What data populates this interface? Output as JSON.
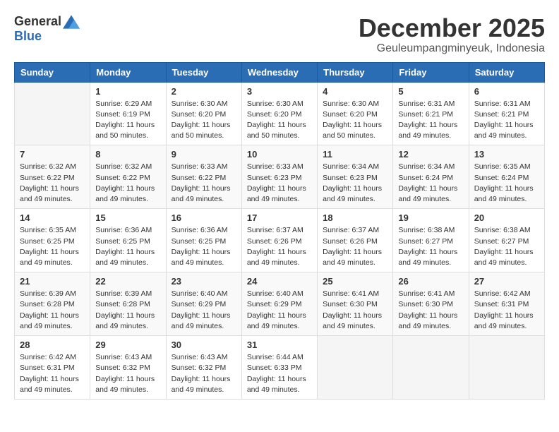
{
  "logo": {
    "general": "General",
    "blue": "Blue"
  },
  "header": {
    "month": "December 2025",
    "location": "Geuleumpangminyeuk, Indonesia"
  },
  "weekdays": [
    "Sunday",
    "Monday",
    "Tuesday",
    "Wednesday",
    "Thursday",
    "Friday",
    "Saturday"
  ],
  "weeks": [
    [
      {
        "day": "",
        "info": ""
      },
      {
        "day": "1",
        "info": "Sunrise: 6:29 AM\nSunset: 6:19 PM\nDaylight: 11 hours\nand 50 minutes."
      },
      {
        "day": "2",
        "info": "Sunrise: 6:30 AM\nSunset: 6:20 PM\nDaylight: 11 hours\nand 50 minutes."
      },
      {
        "day": "3",
        "info": "Sunrise: 6:30 AM\nSunset: 6:20 PM\nDaylight: 11 hours\nand 50 minutes."
      },
      {
        "day": "4",
        "info": "Sunrise: 6:30 AM\nSunset: 6:20 PM\nDaylight: 11 hours\nand 50 minutes."
      },
      {
        "day": "5",
        "info": "Sunrise: 6:31 AM\nSunset: 6:21 PM\nDaylight: 11 hours\nand 49 minutes."
      },
      {
        "day": "6",
        "info": "Sunrise: 6:31 AM\nSunset: 6:21 PM\nDaylight: 11 hours\nand 49 minutes."
      }
    ],
    [
      {
        "day": "7",
        "info": "Sunrise: 6:32 AM\nSunset: 6:22 PM\nDaylight: 11 hours\nand 49 minutes."
      },
      {
        "day": "8",
        "info": "Sunrise: 6:32 AM\nSunset: 6:22 PM\nDaylight: 11 hours\nand 49 minutes."
      },
      {
        "day": "9",
        "info": "Sunrise: 6:33 AM\nSunset: 6:22 PM\nDaylight: 11 hours\nand 49 minutes."
      },
      {
        "day": "10",
        "info": "Sunrise: 6:33 AM\nSunset: 6:23 PM\nDaylight: 11 hours\nand 49 minutes."
      },
      {
        "day": "11",
        "info": "Sunrise: 6:34 AM\nSunset: 6:23 PM\nDaylight: 11 hours\nand 49 minutes."
      },
      {
        "day": "12",
        "info": "Sunrise: 6:34 AM\nSunset: 6:24 PM\nDaylight: 11 hours\nand 49 minutes."
      },
      {
        "day": "13",
        "info": "Sunrise: 6:35 AM\nSunset: 6:24 PM\nDaylight: 11 hours\nand 49 minutes."
      }
    ],
    [
      {
        "day": "14",
        "info": "Sunrise: 6:35 AM\nSunset: 6:25 PM\nDaylight: 11 hours\nand 49 minutes."
      },
      {
        "day": "15",
        "info": "Sunrise: 6:36 AM\nSunset: 6:25 PM\nDaylight: 11 hours\nand 49 minutes."
      },
      {
        "day": "16",
        "info": "Sunrise: 6:36 AM\nSunset: 6:25 PM\nDaylight: 11 hours\nand 49 minutes."
      },
      {
        "day": "17",
        "info": "Sunrise: 6:37 AM\nSunset: 6:26 PM\nDaylight: 11 hours\nand 49 minutes."
      },
      {
        "day": "18",
        "info": "Sunrise: 6:37 AM\nSunset: 6:26 PM\nDaylight: 11 hours\nand 49 minutes."
      },
      {
        "day": "19",
        "info": "Sunrise: 6:38 AM\nSunset: 6:27 PM\nDaylight: 11 hours\nand 49 minutes."
      },
      {
        "day": "20",
        "info": "Sunrise: 6:38 AM\nSunset: 6:27 PM\nDaylight: 11 hours\nand 49 minutes."
      }
    ],
    [
      {
        "day": "21",
        "info": "Sunrise: 6:39 AM\nSunset: 6:28 PM\nDaylight: 11 hours\nand 49 minutes."
      },
      {
        "day": "22",
        "info": "Sunrise: 6:39 AM\nSunset: 6:28 PM\nDaylight: 11 hours\nand 49 minutes."
      },
      {
        "day": "23",
        "info": "Sunrise: 6:40 AM\nSunset: 6:29 PM\nDaylight: 11 hours\nand 49 minutes."
      },
      {
        "day": "24",
        "info": "Sunrise: 6:40 AM\nSunset: 6:29 PM\nDaylight: 11 hours\nand 49 minutes."
      },
      {
        "day": "25",
        "info": "Sunrise: 6:41 AM\nSunset: 6:30 PM\nDaylight: 11 hours\nand 49 minutes."
      },
      {
        "day": "26",
        "info": "Sunrise: 6:41 AM\nSunset: 6:30 PM\nDaylight: 11 hours\nand 49 minutes."
      },
      {
        "day": "27",
        "info": "Sunrise: 6:42 AM\nSunset: 6:31 PM\nDaylight: 11 hours\nand 49 minutes."
      }
    ],
    [
      {
        "day": "28",
        "info": "Sunrise: 6:42 AM\nSunset: 6:31 PM\nDaylight: 11 hours\nand 49 minutes."
      },
      {
        "day": "29",
        "info": "Sunrise: 6:43 AM\nSunset: 6:32 PM\nDaylight: 11 hours\nand 49 minutes."
      },
      {
        "day": "30",
        "info": "Sunrise: 6:43 AM\nSunset: 6:32 PM\nDaylight: 11 hours\nand 49 minutes."
      },
      {
        "day": "31",
        "info": "Sunrise: 6:44 AM\nSunset: 6:33 PM\nDaylight: 11 hours\nand 49 minutes."
      },
      {
        "day": "",
        "info": ""
      },
      {
        "day": "",
        "info": ""
      },
      {
        "day": "",
        "info": ""
      }
    ]
  ]
}
